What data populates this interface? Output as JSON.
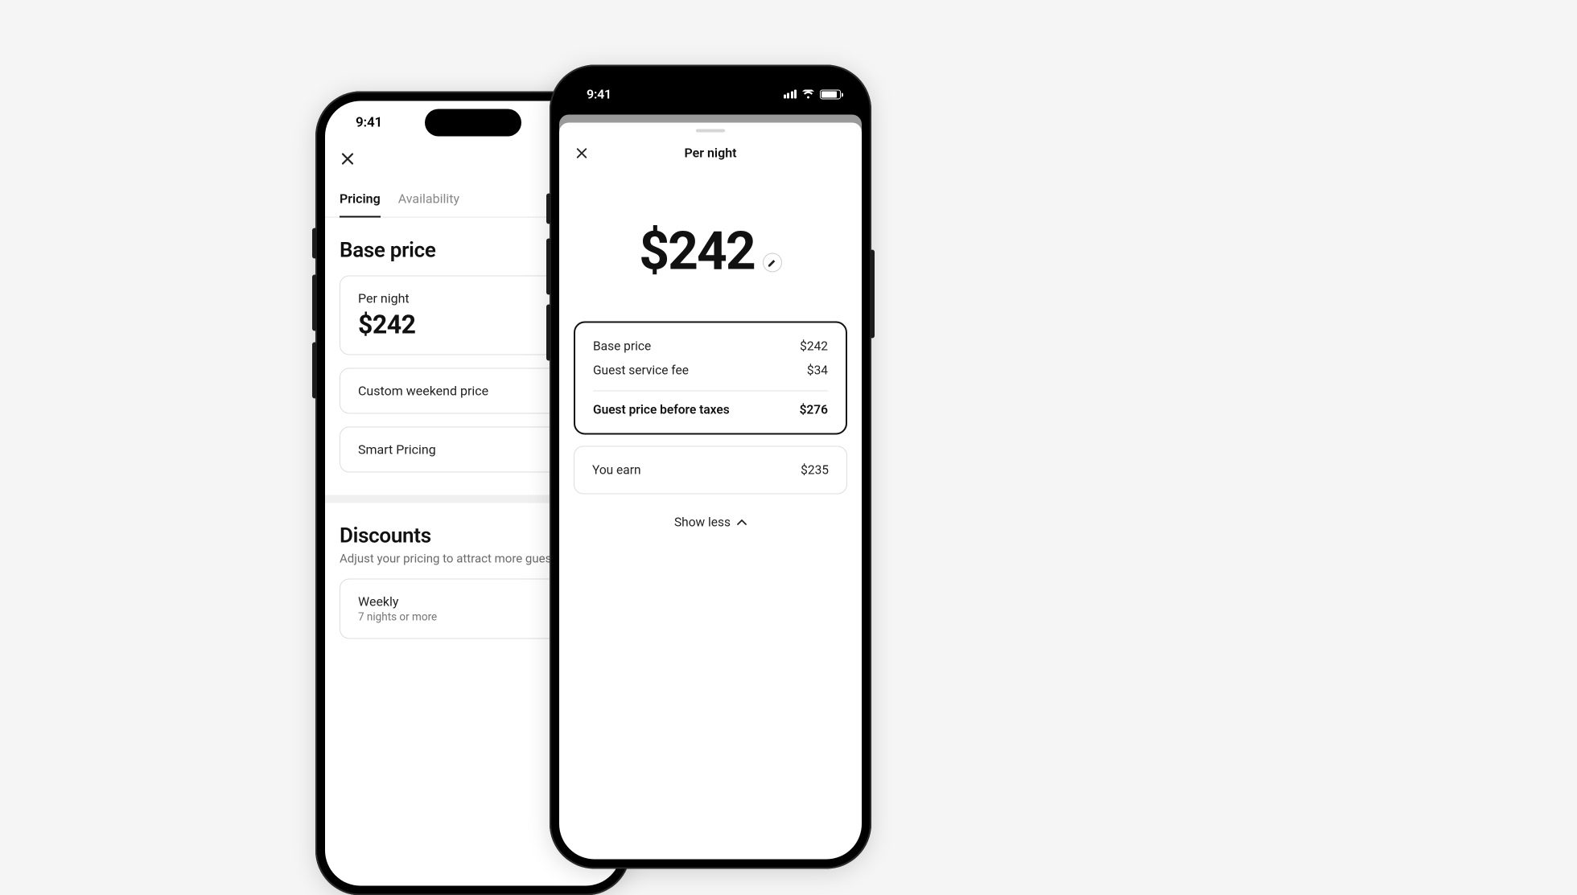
{
  "phone1": {
    "status_time": "9:41",
    "tabs": {
      "pricing": "Pricing",
      "availability": "Availability"
    },
    "base_price": {
      "heading": "Base price",
      "per_night_label": "Per night",
      "per_night_value": "$242",
      "custom_weekend": "Custom weekend price",
      "smart_pricing": "Smart Pricing"
    },
    "discounts": {
      "heading": "Discounts",
      "subtitle": "Adjust your pricing to attract more guests",
      "weekly_label": "Weekly",
      "weekly_sub": "7 nights or more"
    }
  },
  "phone2": {
    "status_time": "9:41",
    "title": "Per night",
    "hero_price": "$242",
    "breakdown": {
      "base_label": "Base price",
      "base_value": "$242",
      "service_label": "Guest service fee",
      "service_value": "$34",
      "total_label": "Guest price before taxes",
      "total_value": "$276"
    },
    "earn": {
      "label": "You earn",
      "value": "$235"
    },
    "toggle": "Show less"
  }
}
